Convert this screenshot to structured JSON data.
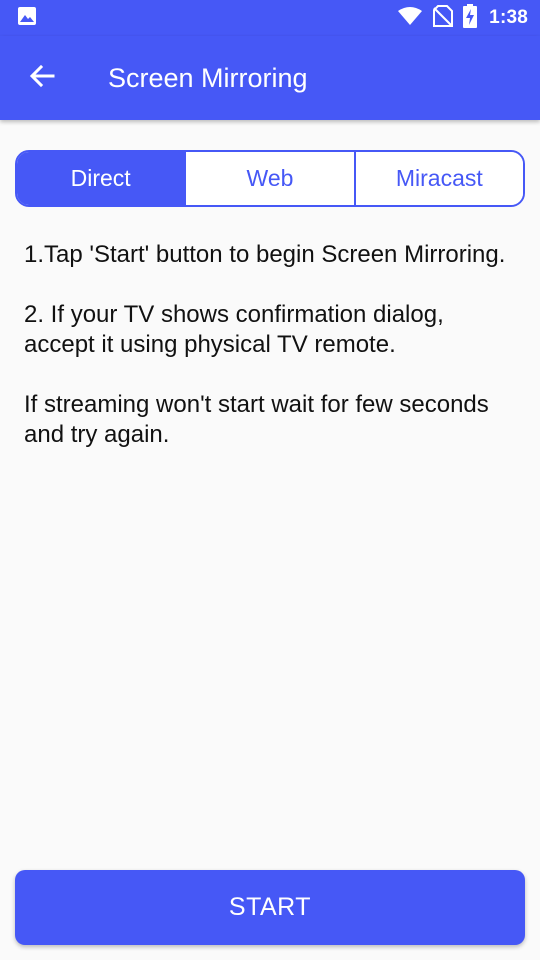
{
  "status_bar": {
    "time": "1:38",
    "icons": [
      "image-icon",
      "wifi-icon",
      "no-sim-icon",
      "battery-charging-icon"
    ]
  },
  "app_bar": {
    "title": "Screen Mirroring",
    "back_icon": "arrow-left-icon"
  },
  "tabs": [
    {
      "label": "Direct",
      "active": true
    },
    {
      "label": "Web",
      "active": false
    },
    {
      "label": "Miracast",
      "active": false
    }
  ],
  "instructions": [
    "1.Tap 'Start' button to begin Screen Mirroring.",
    "2. If your TV shows confirmation dialog, accept it using physical TV remote.",
    "If streaming won't start wait for few seconds and try again."
  ],
  "start_button": {
    "label": "START"
  },
  "colors": {
    "primary": "#4658f6",
    "background": "#fafafa",
    "text": "#111111"
  }
}
